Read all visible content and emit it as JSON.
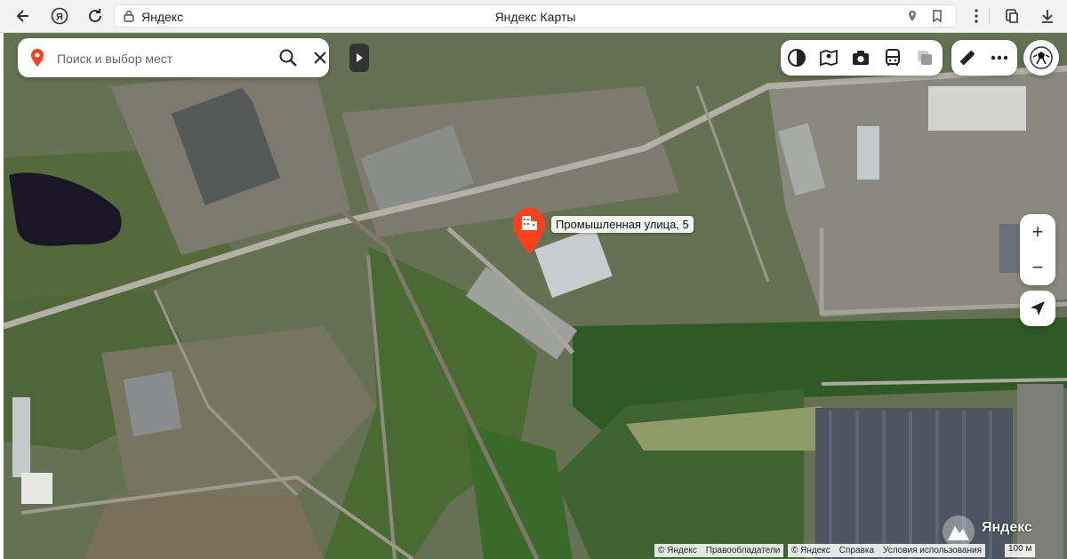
{
  "browser": {
    "host": "Яндекс",
    "title": "Яндекс Карты",
    "nav": [
      "back-icon",
      "yandex-logo-icon",
      "reload-icon"
    ],
    "right_icons": [
      "location-pin-icon",
      "bookmark-icon"
    ],
    "extra_icons": [
      "reader-mode-icon",
      "downloads-icon"
    ]
  },
  "search": {
    "placeholder": "Поиск и выбор мест",
    "icons": [
      "map-pin-icon",
      "search-icon",
      "close-icon"
    ]
  },
  "map": {
    "layer_tools": [
      "traffic-icon",
      "panorama-icon",
      "camera-icon",
      "transport-icon",
      "layers-icon"
    ],
    "extra_tools": [
      "ruler-icon",
      "more-icon"
    ],
    "zoom_in": "+",
    "zoom_out": "−",
    "marker_label": "Промышленная улица, 5",
    "accent": "#fc3f1d"
  },
  "attribution": {
    "copyright_left": "© Яндекс",
    "rights_holders": "Правообладатели",
    "copyright_right": "© Яндекс",
    "help": "Справка",
    "terms": "Условия использования",
    "scale": "100 м",
    "logo_text": "Яндекс"
  }
}
